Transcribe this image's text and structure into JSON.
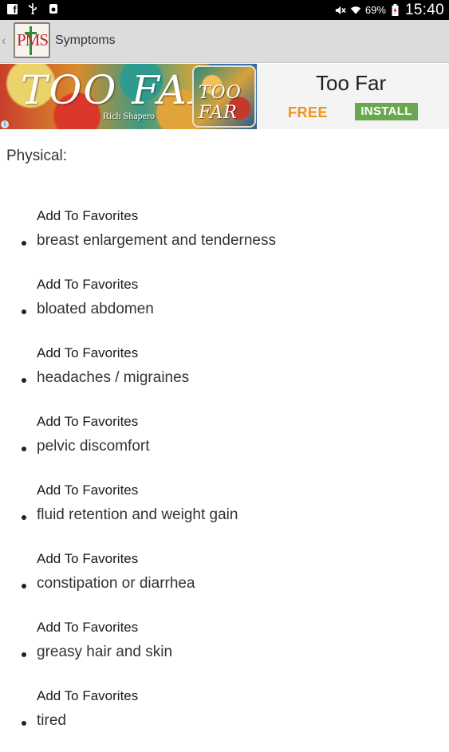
{
  "status_bar": {
    "left_icons": [
      "facebook-icon",
      "usb-icon",
      "download-icon"
    ],
    "battery_percent": "69%",
    "time": "15:40"
  },
  "action_bar": {
    "logo_text": "PMS",
    "title": "Symptoms"
  },
  "ad": {
    "art_title": "TOO FAR",
    "author": "Rich Shapero",
    "thumb_text": "TOO FAR",
    "app_name": "Too Far",
    "price_label": "FREE",
    "install_label": "INSTALL",
    "accent_free": "#f0921e",
    "accent_install": "#6aa84f"
  },
  "content": {
    "section_heading": "Physical:",
    "favorite_label": "Add To Favorites",
    "symptoms": [
      "breast enlargement and tenderness",
      "bloated abdomen",
      "headaches / migraines",
      "pelvic discomfort",
      "fluid retention and weight gain",
      "constipation or diarrhea",
      "greasy hair and skin",
      "tired"
    ]
  }
}
